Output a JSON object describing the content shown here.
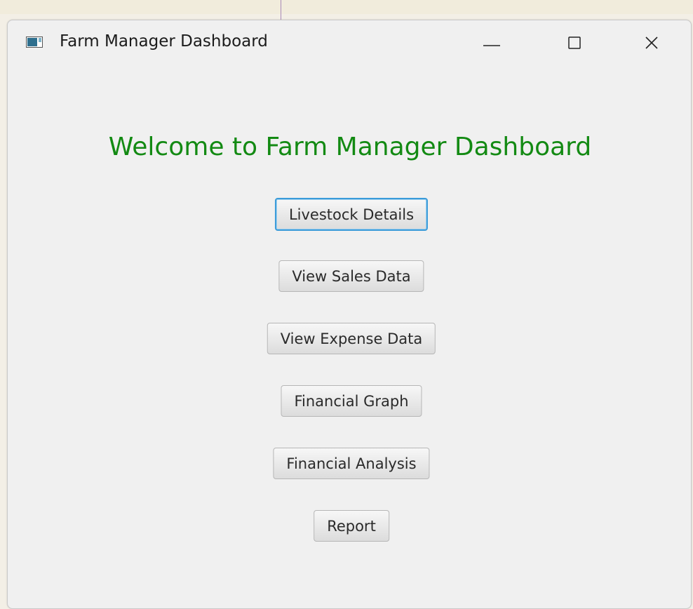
{
  "window": {
    "title": "Farm Manager Dashboard",
    "controls": {
      "minimize": "minimize-icon",
      "maximize": "maximize-icon",
      "close": "close-icon"
    }
  },
  "main": {
    "heading": "Welcome to Farm Manager Dashboard",
    "heading_color": "#138a13",
    "buttons": [
      {
        "label": "Livestock Details"
      },
      {
        "label": "View Sales Data"
      },
      {
        "label": "View Expense Data"
      },
      {
        "label": "Financial Graph"
      },
      {
        "label": "Financial Analysis"
      },
      {
        "label": "Report"
      }
    ]
  },
  "colors": {
    "focus_ring": "#3a9bd9",
    "window_bg": "#f0f0f0"
  }
}
